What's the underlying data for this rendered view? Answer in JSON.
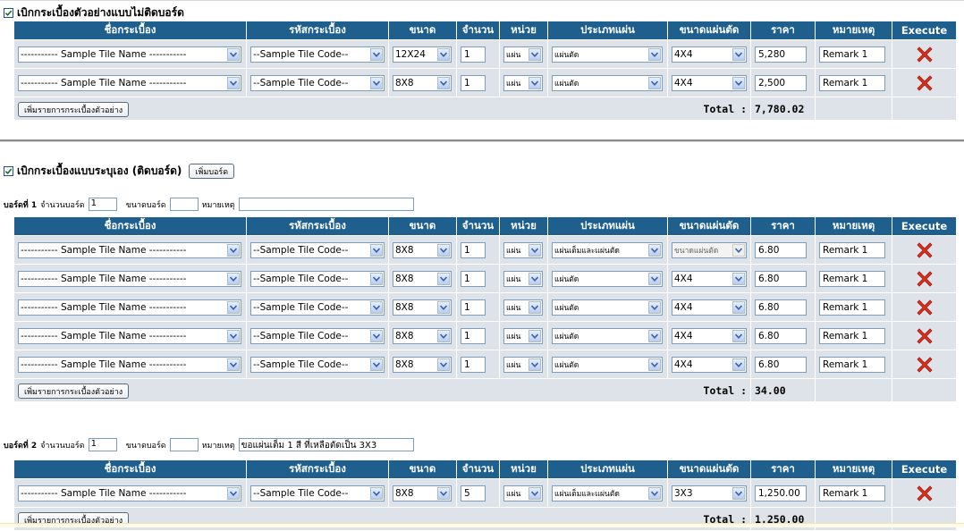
{
  "icons": {
    "checkbox": "checkbox-checked-icon",
    "delete": "red-x-delete-icon",
    "dropdown": "dropdown-arrow-icon"
  },
  "colors": {
    "header_bg": "#1e5f8e",
    "row_bg": "#dde3e9",
    "delete_red": "#d92f1e"
  },
  "columns": [
    "ชื่อกระเบื้อง",
    "รหัสกระเบื้อง",
    "ขนาด",
    "จำนวน",
    "หน่วย",
    "ประเภทแผ่น",
    "ขนาดแผ่นตัด",
    "ราคา",
    "หมายเหตุ",
    "Execute"
  ],
  "add_sample_label": "เพิ่มรายการกระเบื้องตัวอย่าง",
  "total_label": "Total :",
  "section1": {
    "title": "เบิกกระเบื้องตัวอย่างแบบไม่ติดบอร์ด",
    "checked": true,
    "rows": [
      {
        "name": "----------- Sample Tile Name -----------",
        "code": "--Sample Tile Code--",
        "size": "12X24",
        "qty": "1",
        "unit": "แผ่น",
        "sheet_type": "แผ่นตัด",
        "cut_size": "4X4",
        "price": "5,280",
        "remark": "Remark 1"
      },
      {
        "name": "----------- Sample Tile Name -----------",
        "code": "--Sample Tile Code--",
        "size": "8X8",
        "qty": "1",
        "unit": "แผ่น",
        "sheet_type": "แผ่นตัด",
        "cut_size": "4X4",
        "price": "2,500",
        "remark": "Remark 1"
      }
    ],
    "total": "7,780.02"
  },
  "section2": {
    "title": "เบิกกระเบื้องแบบระบุเอง (ติดบอร์ด)",
    "checked": true,
    "add_board_label": "เพิ่มบอร์ด",
    "labels": {
      "board_count": "จำนวนบอร์ด",
      "board_size": "ขนาดบอร์ด",
      "remark": "หมายเหตุ"
    },
    "boards": [
      {
        "title": "บอร์ดที่ 1",
        "count": "1",
        "size": "",
        "remark": "",
        "rows": [
          {
            "name": "----------- Sample Tile Name -----------",
            "code": "--Sample Tile Code--",
            "size": "8X8",
            "qty": "1",
            "unit": "แผ่น",
            "sheet_type": "แผ่นเต็มและแผ่นตัด",
            "cut_size": "ขนาดแผ่นตัด",
            "cut_size_disabled": true,
            "price": "6.80",
            "remark": "Remark 1"
          },
          {
            "name": "----------- Sample Tile Name -----------",
            "code": "--Sample Tile Code--",
            "size": "8X8",
            "qty": "1",
            "unit": "แผ่น",
            "sheet_type": "แผ่นตัด",
            "cut_size": "4X4",
            "price": "6.80",
            "remark": "Remark 1"
          },
          {
            "name": "----------- Sample Tile Name -----------",
            "code": "--Sample Tile Code--",
            "size": "8X8",
            "qty": "1",
            "unit": "แผ่น",
            "sheet_type": "แผ่นตัด",
            "cut_size": "4X4",
            "price": "6.80",
            "remark": "Remark 1"
          },
          {
            "name": "----------- Sample Tile Name -----------",
            "code": "--Sample Tile Code--",
            "size": "8X8",
            "qty": "1",
            "unit": "แผ่น",
            "sheet_type": "แผ่นตัด",
            "cut_size": "4X4",
            "price": "6.80",
            "remark": "Remark 1"
          },
          {
            "name": "----------- Sample Tile Name -----------",
            "code": "--Sample Tile Code--",
            "size": "8X8",
            "qty": "1",
            "unit": "แผ่น",
            "sheet_type": "แผ่นตัด",
            "cut_size": "4X4",
            "price": "6.80",
            "remark": "Remark 1"
          }
        ],
        "total": "34.00"
      },
      {
        "title": "บอร์ดที่ 2",
        "count": "1",
        "size": "",
        "remark": "ขอแผ่นเต็ม 1 สี ที่เหลือตัดเป็น 3X3",
        "rows": [
          {
            "name": "----------- Sample Tile Name -----------",
            "code": "--Sample Tile Code--",
            "size": "8X8",
            "qty": "5",
            "unit": "แผ่น",
            "sheet_type": "แผ่นเต็มและแผ่นตัด",
            "cut_size": "3X3",
            "price": "1,250.00",
            "remark": "Remark 1"
          }
        ],
        "total": "1,250.00"
      }
    ]
  }
}
